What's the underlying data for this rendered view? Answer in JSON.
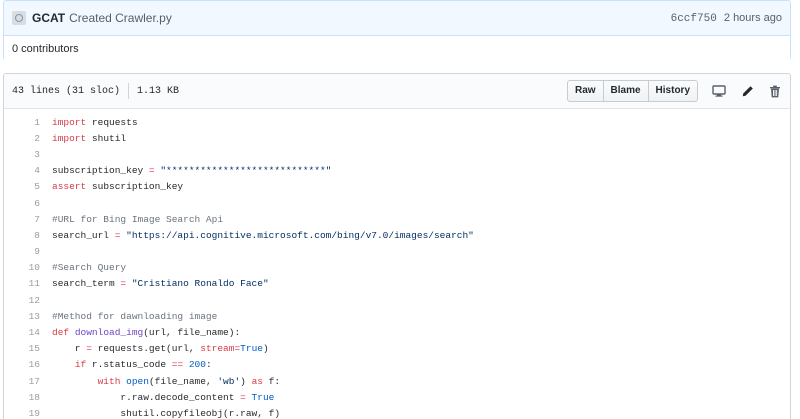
{
  "commit": {
    "author": "GCAT",
    "message": "Created Crawler.py",
    "sha": "6ccf750",
    "time": "2 hours ago",
    "contributors": "0 contributors"
  },
  "file": {
    "lines_info": "43 lines (31 sloc)",
    "size": "1.13 KB",
    "buttons": {
      "raw": "Raw",
      "blame": "Blame",
      "history": "History"
    },
    "icons": [
      "desktop-icon",
      "pencil-icon",
      "trash-icon"
    ]
  },
  "code": {
    "line_numbers": [
      "1",
      "2",
      "3",
      "4",
      "5",
      "6",
      "7",
      "8",
      "9",
      "10",
      "11",
      "12",
      "13",
      "14",
      "15",
      "16",
      "17",
      "18",
      "19"
    ],
    "lines": [
      [
        {
          "t": "k",
          "v": "import"
        },
        {
          "t": "",
          "v": " requests"
        }
      ],
      [
        {
          "t": "k",
          "v": "import"
        },
        {
          "t": "",
          "v": " shutil"
        }
      ],
      [],
      [
        {
          "t": "",
          "v": "subscription_key "
        },
        {
          "t": "k",
          "v": "="
        },
        {
          "t": "",
          "v": " "
        },
        {
          "t": "s",
          "v": "\"****************************\""
        }
      ],
      [
        {
          "t": "k",
          "v": "assert"
        },
        {
          "t": "",
          "v": " subscription_key"
        }
      ],
      [],
      [
        {
          "t": "c",
          "v": "#URL for Bing Image Search Api"
        }
      ],
      [
        {
          "t": "",
          "v": "search_url "
        },
        {
          "t": "k",
          "v": "="
        },
        {
          "t": "",
          "v": " "
        },
        {
          "t": "s",
          "v": "\"https://api.cognitive.microsoft.com/bing/v7.0/images/search\""
        }
      ],
      [],
      [
        {
          "t": "c",
          "v": "#Search Query"
        }
      ],
      [
        {
          "t": "",
          "v": "search_term "
        },
        {
          "t": "k",
          "v": "="
        },
        {
          "t": "",
          "v": " "
        },
        {
          "t": "s",
          "v": "\"Cristiano Ronaldo Face\""
        }
      ],
      [],
      [
        {
          "t": "c",
          "v": "#Method for dawnloading image"
        }
      ],
      [
        {
          "t": "k",
          "v": "def"
        },
        {
          "t": "",
          "v": " "
        },
        {
          "t": "f",
          "v": "download_img"
        },
        {
          "t": "",
          "v": "(url, file_name):"
        }
      ],
      [
        {
          "t": "",
          "v": "    r "
        },
        {
          "t": "k",
          "v": "="
        },
        {
          "t": "",
          "v": " requests.get(url, "
        },
        {
          "t": "k",
          "v": "stream"
        },
        {
          "t": "k",
          "v": "="
        },
        {
          "t": "b",
          "v": "True"
        },
        {
          "t": "",
          "v": ")"
        }
      ],
      [
        {
          "t": "",
          "v": "    "
        },
        {
          "t": "k",
          "v": "if"
        },
        {
          "t": "",
          "v": " r.status_code "
        },
        {
          "t": "k",
          "v": "=="
        },
        {
          "t": "",
          "v": " "
        },
        {
          "t": "b",
          "v": "200"
        },
        {
          "t": "",
          "v": ":"
        }
      ],
      [
        {
          "t": "",
          "v": "        "
        },
        {
          "t": "k",
          "v": "with"
        },
        {
          "t": "",
          "v": " "
        },
        {
          "t": "b",
          "v": "open"
        },
        {
          "t": "",
          "v": "(file_name, "
        },
        {
          "t": "s",
          "v": "'wb'"
        },
        {
          "t": "",
          "v": ") "
        },
        {
          "t": "k",
          "v": "as"
        },
        {
          "t": "",
          "v": " f:"
        }
      ],
      [
        {
          "t": "",
          "v": "            r.raw.decode_content "
        },
        {
          "t": "k",
          "v": "="
        },
        {
          "t": "",
          "v": " "
        },
        {
          "t": "b",
          "v": "True"
        }
      ],
      [
        {
          "t": "",
          "v": "            shutil.copyfileobj(r.raw, f)"
        }
      ]
    ]
  }
}
